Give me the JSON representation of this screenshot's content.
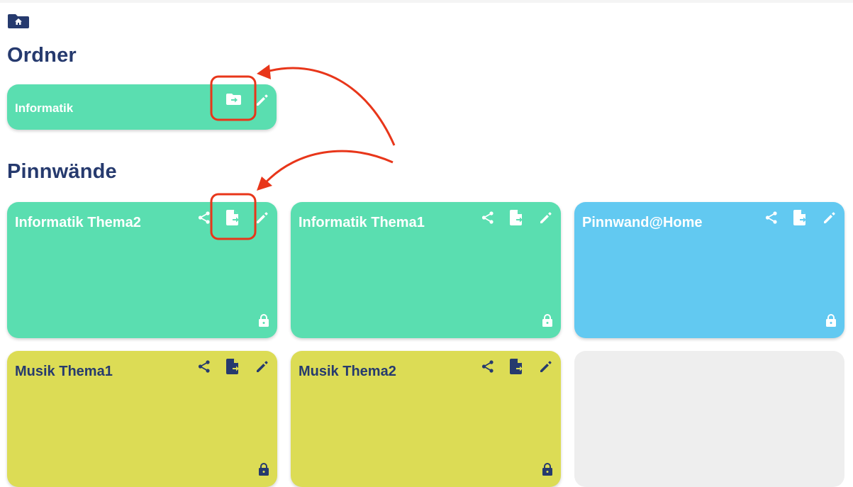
{
  "sections": {
    "folders_title": "Ordner",
    "boards_title": "Pinnwände"
  },
  "folders": [
    {
      "name": "Informatik",
      "color": "#5adeb0"
    }
  ],
  "boards": [
    {
      "title": "Informatik Thema2",
      "color": "#5adeb0",
      "text_color": "#ffffff"
    },
    {
      "title": "Informatik Thema1",
      "color": "#5adeb0",
      "text_color": "#ffffff"
    },
    {
      "title": "Pinnwand@Home",
      "color": "#62c9f1",
      "text_color": "#ffffff"
    },
    {
      "title": "Musik Thema1",
      "color": "#dcdc55",
      "text_color": "#263a6e"
    },
    {
      "title": "Musik Thema2",
      "color": "#dcdc55",
      "text_color": "#263a6e"
    }
  ],
  "icons": {
    "home": "folder-home-icon",
    "folder_move": "folder-move-icon",
    "share": "share-icon",
    "move": "file-move-icon",
    "edit": "pencil-icon",
    "lock": "lock-icon"
  },
  "annotations": {
    "highlight_color": "#e8361a"
  }
}
